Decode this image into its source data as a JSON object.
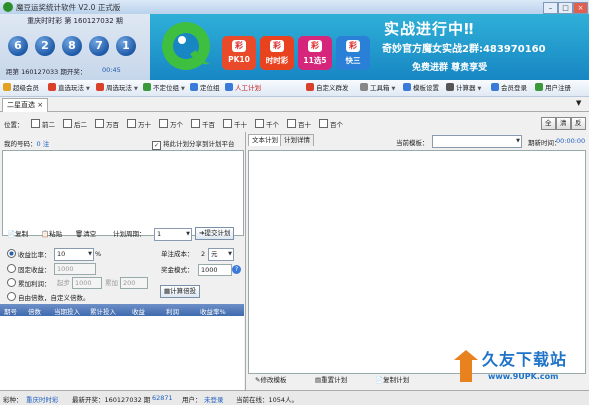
{
  "window": {
    "title": "魔豆运奖统计软件 V2.0 正式版"
  },
  "lottery": {
    "issue": "重庆时时彩 第 160127032 期",
    "balls": [
      "6",
      "2",
      "8",
      "7",
      "1"
    ],
    "next_label": "距第 160127033 期开奖：",
    "countdown": "00:45"
  },
  "banner": {
    "tiles": [
      {
        "badge": "彩",
        "label": "PK10",
        "color": "#e94b2a"
      },
      {
        "badge": "彩",
        "label": "时时彩",
        "color": "#e8421f"
      },
      {
        "badge": "彩",
        "label": "11选5",
        "color": "#d6267b"
      },
      {
        "badge": "彩",
        "label": "快三",
        "color": "#2a7fd6"
      }
    ],
    "headline": "实战进行中‼",
    "group_text": "奇妙官方魔女实战2群:483970160",
    "slogan": "免费进群  尊贵享受"
  },
  "toolbar": {
    "items": [
      "超级会员",
      "直选玩法",
      "周选玩法",
      "不定位组",
      "定位组",
      "人工计划",
      "自定义群发",
      "工具箱",
      "模板设置",
      "计算器",
      "会员登录",
      "用户注册"
    ]
  },
  "tab": {
    "label": "二星直选"
  },
  "positions": {
    "label": "位置：",
    "options": [
      "前二",
      "后二",
      "万百",
      "万十",
      "万个",
      "千百",
      "千十",
      "千个",
      "百十",
      "百个"
    ],
    "buttons": [
      "全",
      "清",
      "反"
    ]
  },
  "left": {
    "my_numbers_label": "我的号码：",
    "my_numbers_count": "0 注",
    "share_label": "将此计划分享到计划平台",
    "copy": "复制",
    "paste": "粘贴",
    "clear": "清空",
    "period_label": "计划周期：",
    "period_value": "1",
    "submit": "提交计划",
    "ratio_label": "收益比率：",
    "ratio_value": "10",
    "ratio_unit": "%",
    "unit_cost_label": "单注成本：",
    "unit_cost_value": "2",
    "unit_cost_unit": "元",
    "fixed_label": "固定收益：",
    "fixed_value": "1000",
    "prize_mode_label": "奖金模式：",
    "prize_mode_value": "1000",
    "cumulative_label": "累加利润：",
    "start_label": "起步",
    "start_value": "1000",
    "increment_label": "累加",
    "increment_value": "200",
    "free_label": "自由倍数，自定义倍数。",
    "calc_button": "计算倍投",
    "table_headers": [
      "期号",
      "倍数",
      "当期投入",
      "累计投入",
      "收益",
      "利润",
      "收益率%"
    ]
  },
  "right": {
    "tabs": [
      "文本计划",
      "计划详情"
    ],
    "template_label": "当前模板：",
    "period_time_label": "期新时间：",
    "period_time_value": "00:00:00",
    "bottom_buttons": [
      "修改模板",
      "重置计划",
      "复制计划"
    ]
  },
  "status": {
    "lottery_label": "彩种：",
    "lottery_value": "重庆时时彩",
    "latest_label": "最新开奖：160127032 期",
    "latest_value": "62871",
    "user_label": "用户：",
    "user_value": "未登录",
    "online_label": "当前在线：1054人。"
  },
  "watermark": {
    "line1": "久友下载站",
    "line2": "www.9UPK.com"
  }
}
